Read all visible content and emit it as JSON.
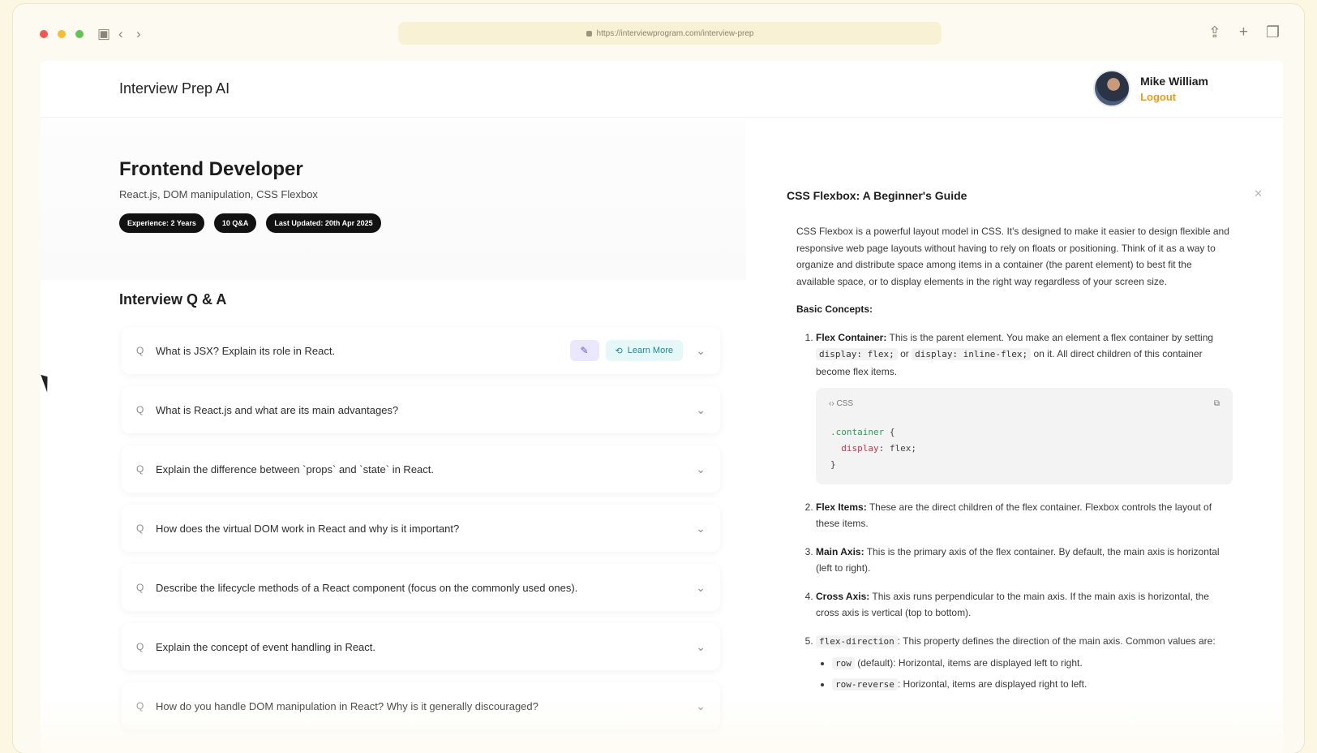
{
  "browser": {
    "url": "https://interviewprogram.com/interview-prep"
  },
  "header": {
    "brand": "Interview Prep AI",
    "user_name": "Mike William",
    "logout_label": "Logout"
  },
  "hero": {
    "role": "Frontend Developer",
    "topics": "React.js, DOM manipulation, CSS Flexbox",
    "badges": [
      "Experience: 2 Years",
      "10 Q&A",
      "Last Updated: 20th Apr 2025"
    ]
  },
  "qa": {
    "title": "Interview Q & A",
    "q_prefix": "Q",
    "items": [
      {
        "question": "What is JSX? Explain its role in React."
      },
      {
        "question": "What is React.js and what are its main advantages?"
      },
      {
        "question": "Explain the difference between `props` and `state` in React."
      },
      {
        "question": "How does the virtual DOM work in React and why is it important?"
      },
      {
        "question": "Describe the lifecycle methods of a React component (focus on the commonly used ones)."
      },
      {
        "question": "Explain the concept of event handling in React."
      },
      {
        "question": "How do you handle DOM manipulation in React? Why is it generally discouraged?"
      }
    ],
    "learn_more_label": "Learn More"
  },
  "drawer": {
    "title": "CSS Flexbox: A Beginner's Guide",
    "intro": "CSS Flexbox is a powerful layout model in CSS. It's designed to make it easier to design flexible and responsive web page layouts without having to rely on floats or positioning. Think of it as a way to organize and distribute space among items in a container (the parent element) to best fit the available space, or to display elements in the right way regardless of your screen size.",
    "basic_concepts": "Basic Concepts:",
    "concepts": [
      {
        "term": "Flex Container:",
        "text1": "This is the parent element. You make an element a flex container by setting",
        "code1": "display: flex;",
        "or": "or",
        "code2": "display: inline-flex;",
        "text2": "on it. All direct children of this container become flex items."
      },
      {
        "term": "Flex Items:",
        "text": "These are the direct children of the flex container. Flexbox controls the layout of these items."
      },
      {
        "term": "Main Axis:",
        "text": "This is the primary axis of the flex container. By default, the main axis is horizontal (left to right)."
      },
      {
        "term": "Cross Axis:",
        "text": "This axis runs perpendicular to the main axis. If the main axis is horizontal, the cross axis is vertical (top to bottom)."
      },
      {
        "term": "flex-direction",
        "text": ": This property defines the direction of the main axis. Common values are:"
      }
    ],
    "code_lang": "CSS",
    "code": {
      "selector": ".container",
      "open": " {",
      "prop": "  display",
      "value": ": flex;",
      "close": "}"
    },
    "bullets": [
      {
        "code": "row",
        "text": "(default): Horizontal, items are displayed left to right."
      },
      {
        "code": "row-reverse",
        "text": ": Horizontal, items are displayed right to left."
      }
    ]
  },
  "colors": {
    "accent": "#f29a16",
    "badge_bg": "#121212",
    "learn_more_bg": "#e6f7f8",
    "pin_bg": "#ebe7ff"
  }
}
